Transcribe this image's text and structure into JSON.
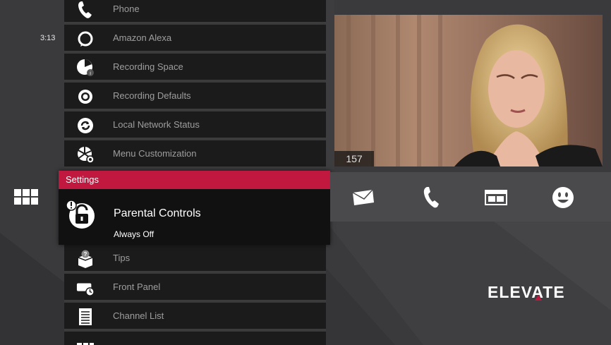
{
  "clock": "3:13",
  "menu_items": [
    {
      "id": "phone",
      "label": "Phone",
      "icon": "phone-icon"
    },
    {
      "id": "alexa",
      "label": "Amazon Alexa",
      "icon": "alexa-icon"
    },
    {
      "id": "recording-space",
      "label": "Recording Space",
      "icon": "recording-space-icon"
    },
    {
      "id": "recording-defaults",
      "label": "Recording Defaults",
      "icon": "gear-icon"
    },
    {
      "id": "network-status",
      "label": "Local Network Status",
      "icon": "network-refresh-icon"
    },
    {
      "id": "menu-customization",
      "label": "Menu Customization",
      "icon": "menu-customization-icon"
    },
    {
      "id": "tips",
      "label": "Tips",
      "icon": "tips-icon"
    },
    {
      "id": "front-panel",
      "label": "Front Panel",
      "icon": "front-panel-icon"
    },
    {
      "id": "channel-list",
      "label": "Channel List",
      "icon": "channel-list-icon"
    }
  ],
  "selected": {
    "category": "Settings",
    "title": "Parental Controls",
    "status": "Always Off",
    "icon": "padlock-icon"
  },
  "video": {
    "channel": "157"
  },
  "actions": [
    {
      "id": "messages",
      "icon": "envelope-icon"
    },
    {
      "id": "phone",
      "icon": "phone-icon"
    },
    {
      "id": "guide",
      "icon": "window-icon"
    },
    {
      "id": "smiley",
      "icon": "smiley-icon"
    }
  ],
  "brand": {
    "logo_text": "ELEVATE",
    "accent": "#c0183f"
  }
}
